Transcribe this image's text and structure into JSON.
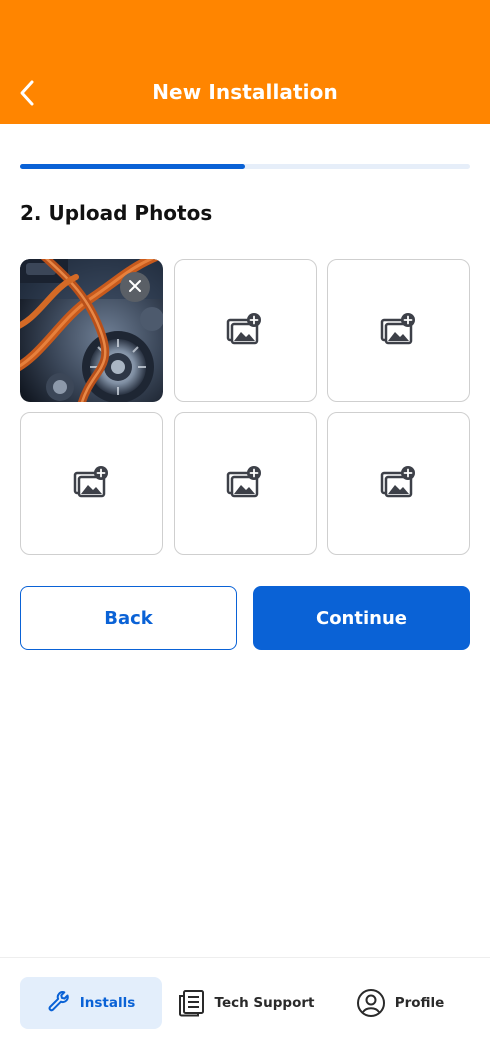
{
  "header": {
    "title": "New Installation",
    "back_icon": "chevron-left-icon",
    "background_color": "#ff8500"
  },
  "progress": {
    "fraction": 0.5,
    "fill_color": "#0a62d6",
    "track_color": "#e6eef9"
  },
  "section": {
    "title": "2. Upload Photos"
  },
  "photos": {
    "slots": [
      {
        "state": "uploaded",
        "image": "engine-cable-photo",
        "remove_icon": "close-icon"
      },
      {
        "state": "empty",
        "icon": "add-photo-icon"
      },
      {
        "state": "empty",
        "icon": "add-photo-icon"
      },
      {
        "state": "empty",
        "icon": "add-photo-icon"
      },
      {
        "state": "empty",
        "icon": "add-photo-icon"
      },
      {
        "state": "empty",
        "icon": "add-photo-icon"
      }
    ]
  },
  "actions": {
    "back_label": "Back",
    "continue_label": "Continue",
    "accent_color": "#0a62d6"
  },
  "nav": {
    "items": [
      {
        "label": "Installs",
        "icon": "wrench-icon",
        "active": true
      },
      {
        "label": "Tech Support",
        "icon": "document-list-icon",
        "active": false
      },
      {
        "label": "Profile",
        "icon": "user-circle-icon",
        "active": false
      }
    ]
  }
}
